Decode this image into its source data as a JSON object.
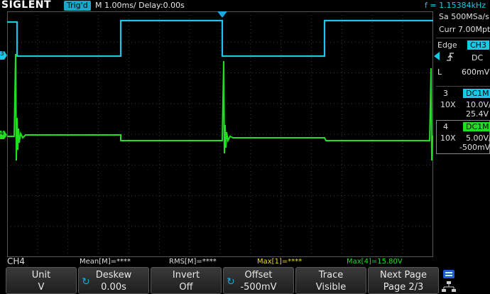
{
  "top_bar": {
    "logo": "SIGLENT",
    "trigger_status": "Trig'd",
    "timebase": "M 1.00ms/ Delay:0.00s",
    "frequency": "f = 1.15384kHz"
  },
  "acquisition": {
    "sample_rate": "Sa 500MSa/s",
    "memory_depth": "Curr 7.00Mpts"
  },
  "trigger": {
    "type": "Edge",
    "source": "CH3",
    "slope_icon": "rising-edge-icon",
    "coupling": "DC",
    "level_label": "L",
    "level": "600mV"
  },
  "channels": [
    {
      "number": "3",
      "coupling": "DC1M",
      "probe": "10X",
      "scale": "10.0V/",
      "offset": "25.4V",
      "color": "#19c8e8"
    },
    {
      "number": "4",
      "coupling": "DC1M",
      "probe": "10X",
      "scale": "5.00V/",
      "offset": "-500mV",
      "color": "#22dd22"
    }
  ],
  "measurements": {
    "source": "CH4",
    "mean": "Mean[M]=****",
    "rms": "RMS[M]=****",
    "max1": "Max[1]=****",
    "max4": "Max[4]=15.80V"
  },
  "softkeys": [
    {
      "label": "Unit",
      "value": "V"
    },
    {
      "label": "Deskew",
      "value": "0.00s"
    },
    {
      "label": "Invert",
      "value": "Off"
    },
    {
      "label": "Offset",
      "value": "-500mV"
    },
    {
      "label": "Trace",
      "value": "Visible"
    },
    {
      "label": "Next Page",
      "value": "Page 2/3"
    }
  ],
  "markers": {
    "ch3_marker": "3",
    "ch4_marker": "4"
  },
  "colors": {
    "ch3": "#19c8e8",
    "ch4": "#22dd22",
    "max1_text": "#e8e000",
    "grid": "#3a3a3a"
  }
}
